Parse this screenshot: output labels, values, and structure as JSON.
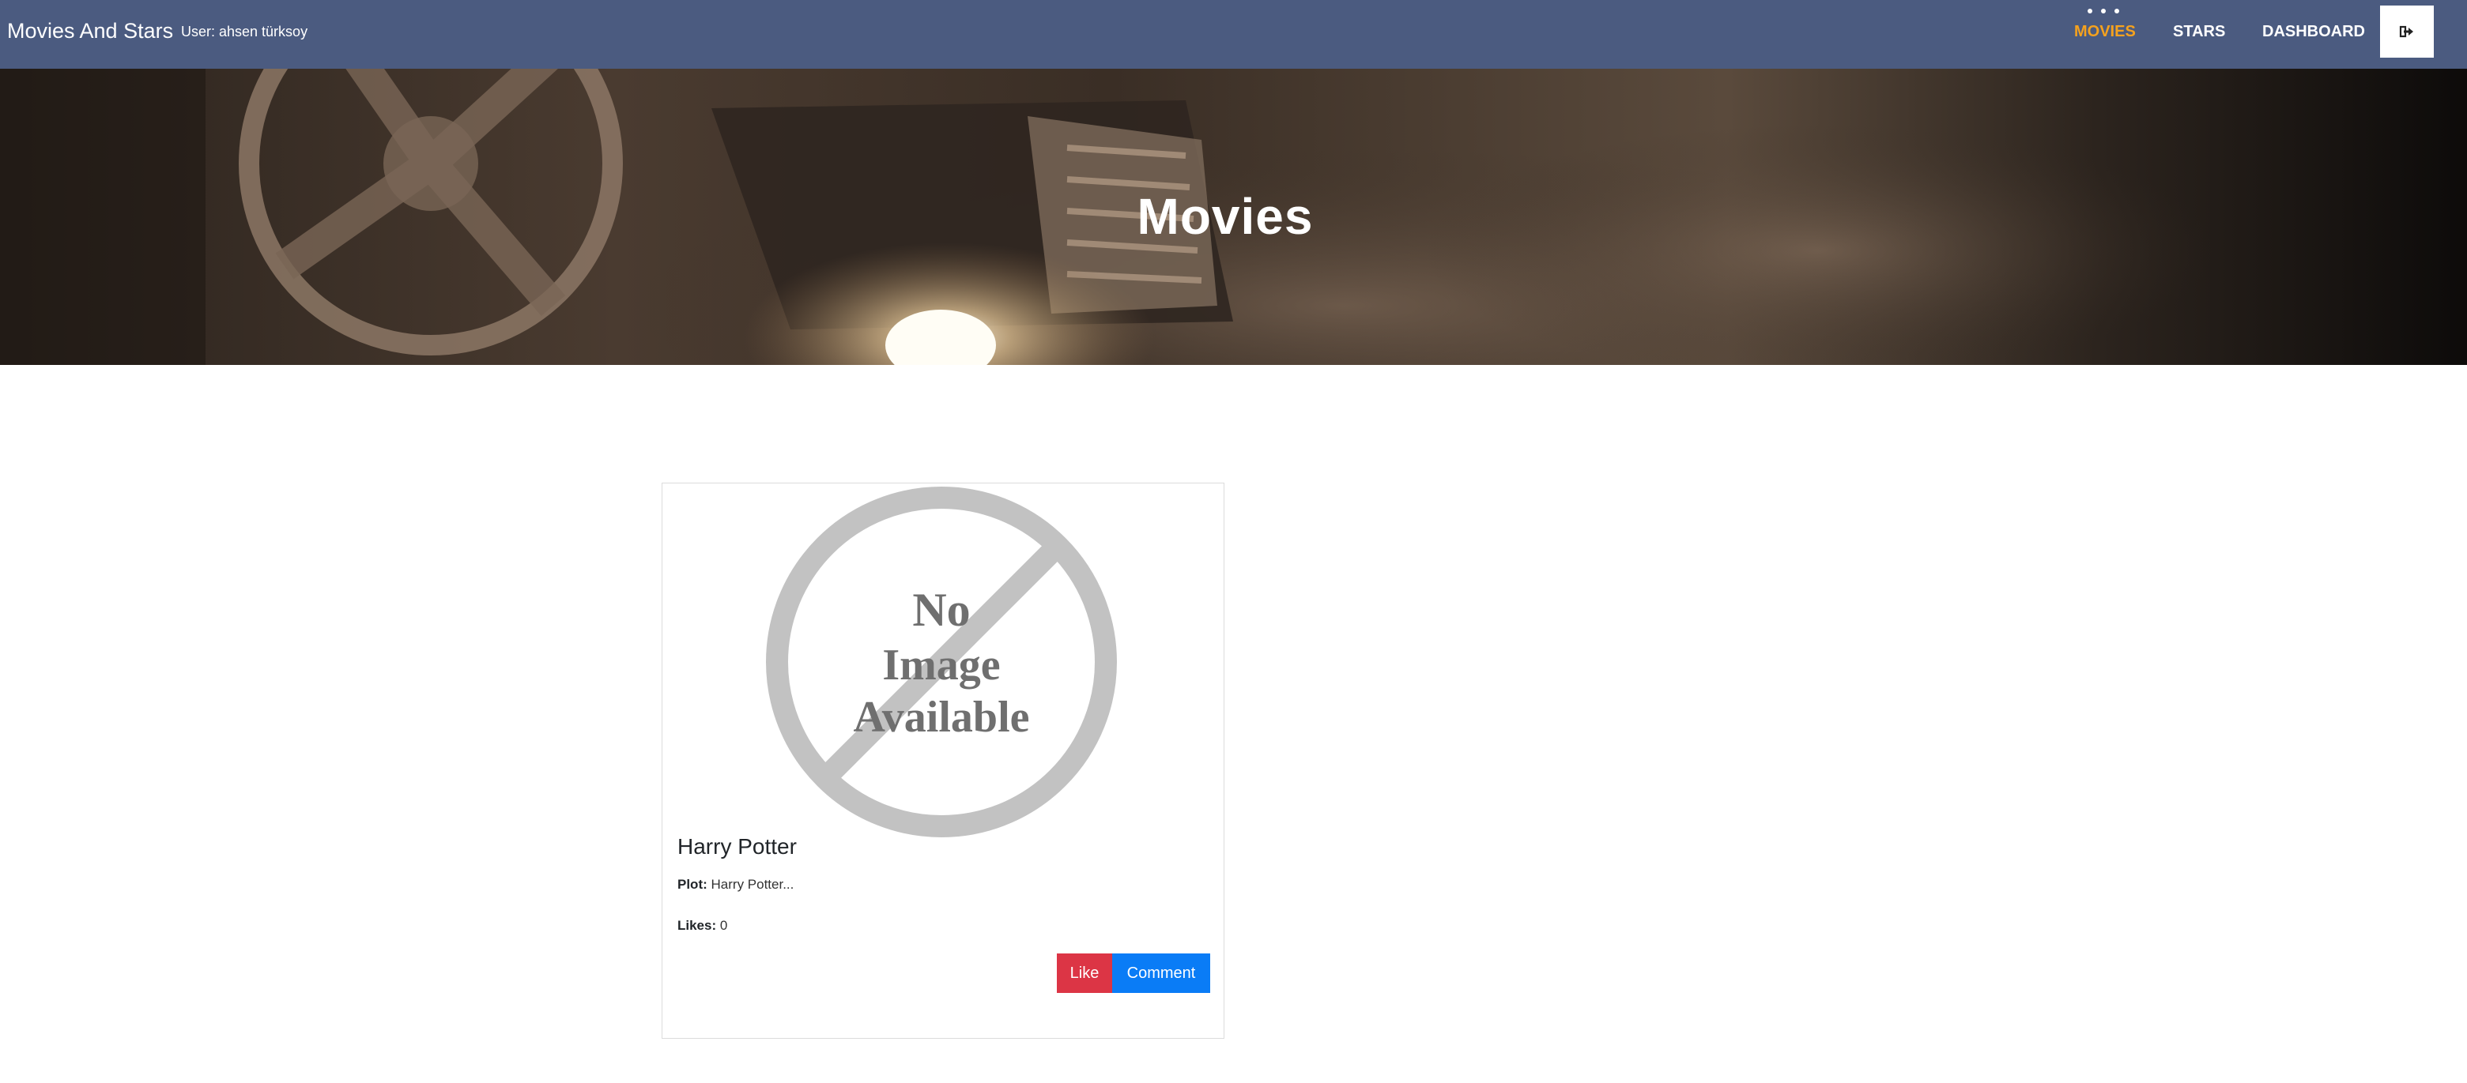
{
  "navbar": {
    "brand": "Movies And Stars",
    "user_label": "User: ahsen türksoy",
    "links": [
      {
        "label": "MOVIES",
        "active": true
      },
      {
        "label": "STARS",
        "active": false
      },
      {
        "label": "DASHBOARD",
        "active": false
      }
    ],
    "logout_icon": "sign-out-icon",
    "bg_color": "#4b5b80",
    "active_color": "#f5a21e"
  },
  "hero": {
    "title": "Movies"
  },
  "movies": [
    {
      "title": "Harry Potter",
      "image_text": [
        "No",
        "Image",
        "Available"
      ],
      "plot_label": "Plot:",
      "plot_value": "Harry Potter...",
      "likes_label": "Likes:",
      "likes_value": "0",
      "like_button": "Like",
      "comment_button": "Comment"
    }
  ],
  "colors": {
    "like": "#dc3545",
    "comment": "#0a7cf6"
  }
}
